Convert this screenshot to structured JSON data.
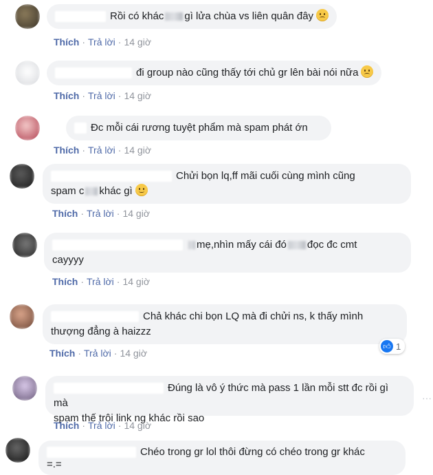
{
  "actions": {
    "like": "Thích",
    "reply": "Trả lời",
    "sep": "·"
  },
  "comments": [
    {
      "text": "Rồi có khác",
      "text2": "gì lửa chùa vs liên quân đây",
      "emoji": "sad",
      "time": "14 giờ"
    },
    {
      "text": "đi group nào cũng thấy tới chủ gr lên bài nói nữa",
      "emoji": "sad",
      "time": "14 giờ"
    },
    {
      "text": "Đc mỗi cái rương tuyệt phẩm mà spam phát ớn",
      "time": "14 giờ"
    },
    {
      "text": "Chửi bọn lq,ff mãi cuối cùng mình cũng",
      "line2a": "spam c",
      "line2b": "khác gì",
      "emoji": "smile",
      "time": "14 giờ"
    },
    {
      "text": "mẹ,nhìn mấy cái đó",
      "text2": "đọc đc cmt",
      "line2": "cayyyy",
      "time": "14 giờ"
    },
    {
      "text": "Chả khác chi bọn LQ mà đi chửi ns, k thấy mình",
      "line2": "thượng đẳng à haizzz",
      "time": "14 giờ",
      "likes": "1"
    },
    {
      "text": "Đúng là vô ý thức mà pass 1 lần mỗi stt đc rồi gì mà",
      "line2": "spam thế trôi link ng khác rồi sao",
      "time": "14 giờ"
    },
    {
      "text": "Chéo trong gr lol thôi đừng có chéo trong gr khác",
      "line2": "=.="
    }
  ],
  "colors": {
    "bubble": "#f2f3f5",
    "link": "#4f6aa8",
    "meta": "#90949c",
    "like_blue": "#1877f2"
  },
  "icons": [
    "sad-emoji-icon",
    "smile-emoji-icon",
    "like-reaction-icon",
    "more-options-icon"
  ]
}
